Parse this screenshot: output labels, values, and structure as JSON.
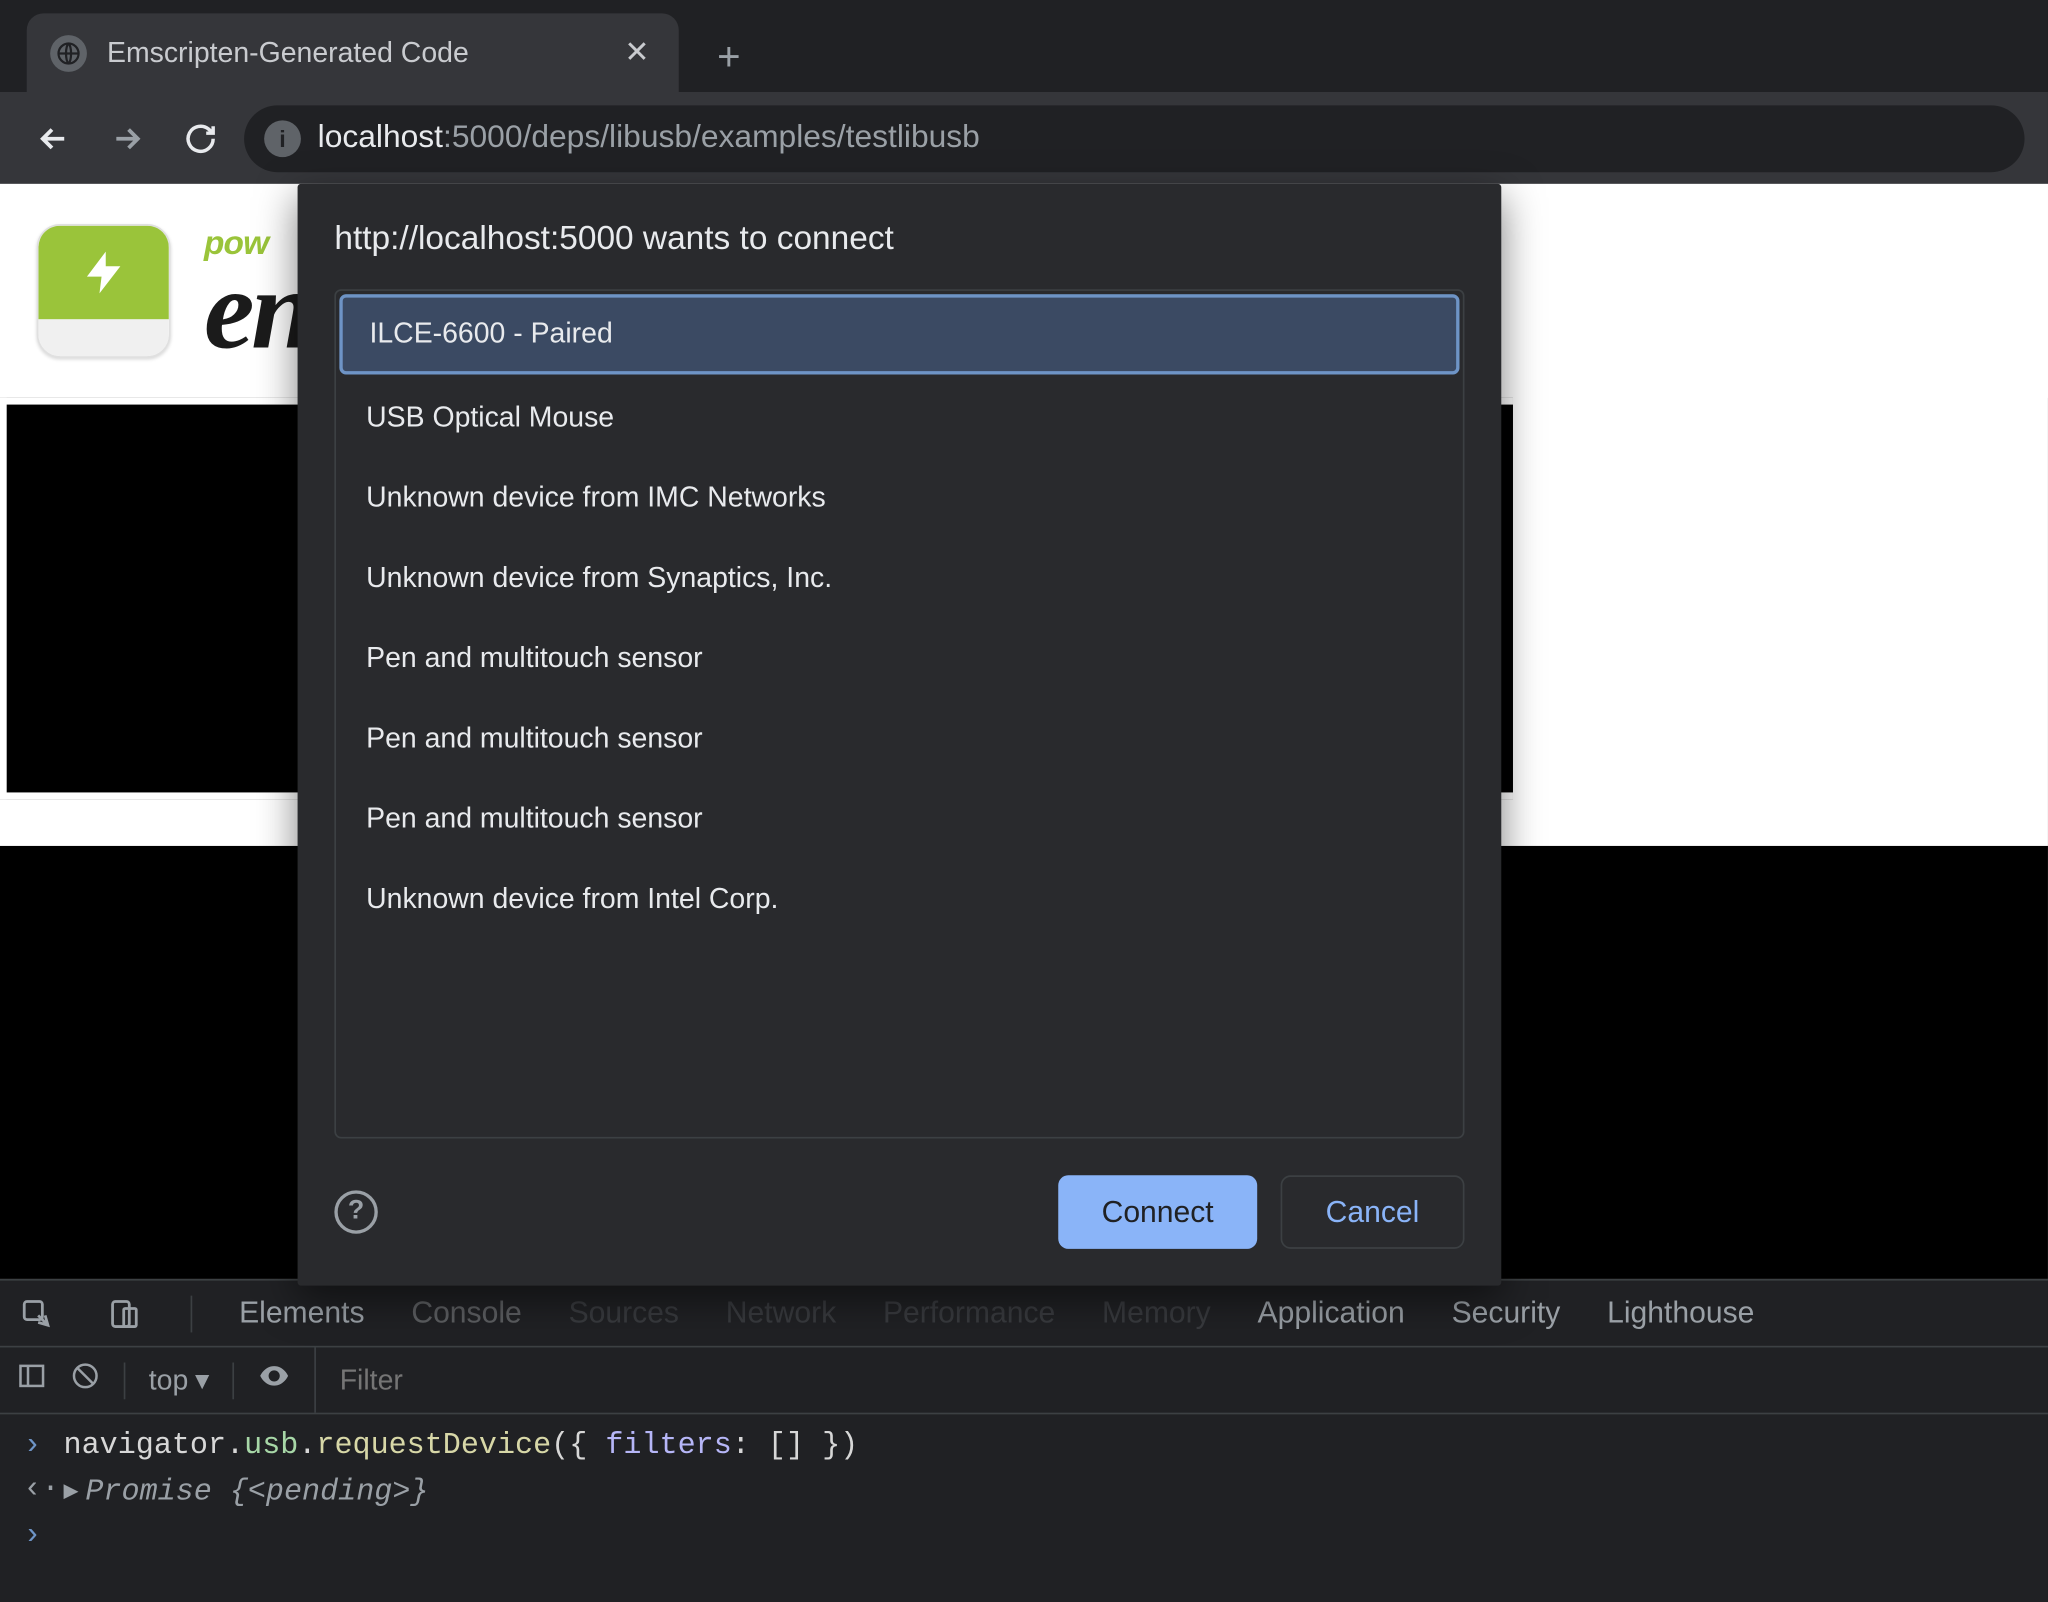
{
  "tab": {
    "title": "Emscripten-Generated Code"
  },
  "url": {
    "host": "localhost",
    "port_path": ":5000/deps/libusb/examples/testlibusb"
  },
  "page": {
    "pow": "pow",
    "en": "en"
  },
  "dialog": {
    "prompt": "http://localhost:5000 wants to connect",
    "devices": [
      "ILCE-6600 - Paired",
      "USB Optical Mouse",
      "Unknown device from IMC Networks",
      "Unknown device from Synaptics, Inc.",
      "Pen and multitouch sensor",
      "Pen and multitouch sensor",
      "Pen and multitouch sensor",
      "Unknown device from Intel Corp."
    ],
    "connect": "Connect",
    "cancel": "Cancel",
    "help": "?"
  },
  "devtools": {
    "tabs": [
      "Elements",
      "Console",
      "Sources",
      "Network",
      "Performance",
      "Memory",
      "Application",
      "Security",
      "Lighthouse"
    ],
    "context": "top",
    "filter_placeholder": "Filter",
    "input_gutter": ">",
    "output_gutter": "<·",
    "code_input": "navigator.usb.requestDevice({ filters: [] })",
    "code_output_prefix": "Promise ",
    "code_output_inner": "{<pending>}",
    "prompt_gutter": ">"
  }
}
